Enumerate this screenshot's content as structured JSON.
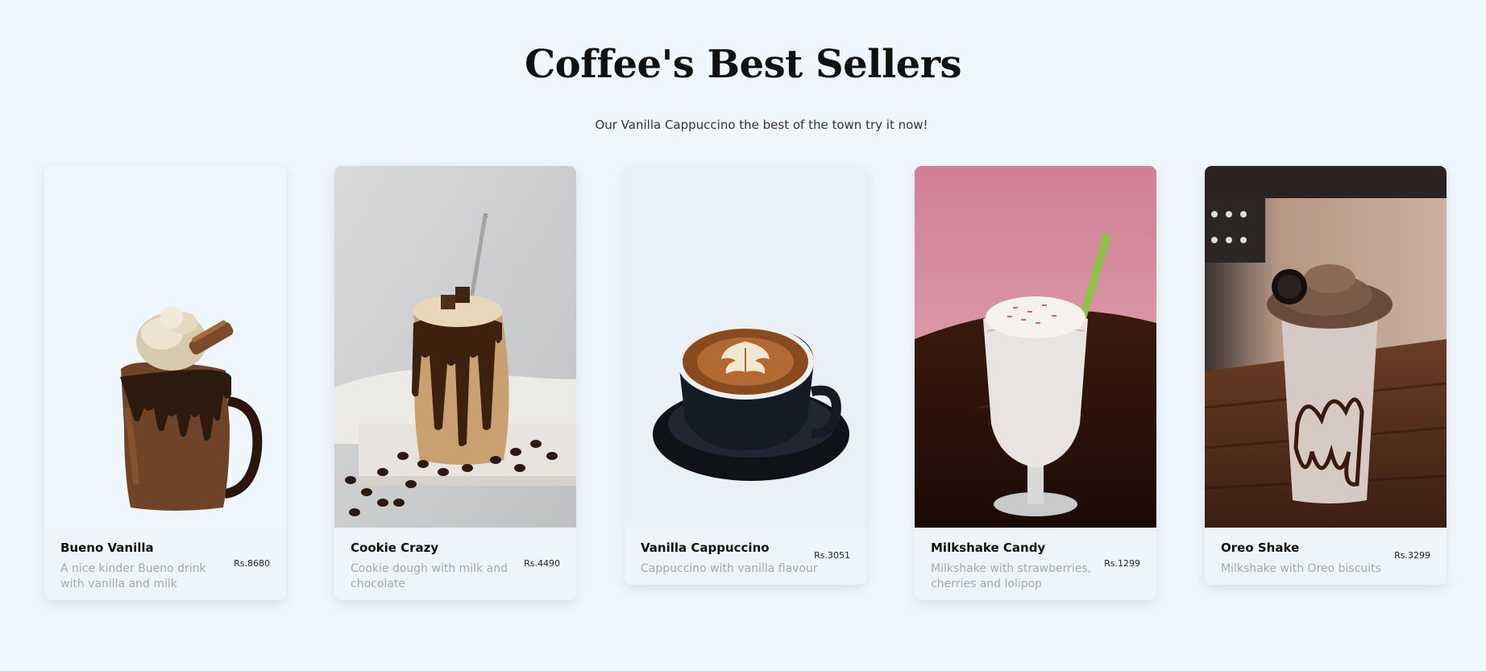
{
  "header": {
    "title": "Coffee's Best Sellers",
    "subtitle": "Our Vanilla Cappuccino the best of the town try it now!"
  },
  "products": [
    {
      "name": "Bueno Vanilla",
      "description": "A nice kinder Bueno drink with vanilla and milk",
      "price": "Rs.8680",
      "image": "chocolate-freakshake-mug-image"
    },
    {
      "name": "Cookie Crazy",
      "description": "Cookie dough with milk and chocolate",
      "price": "Rs.4490",
      "image": "cookie-jar-shake-image"
    },
    {
      "name": "Vanilla Cappuccino",
      "description": "Cappuccino with vanilla flavour",
      "price": "Rs.3051",
      "image": "latte-cup-image"
    },
    {
      "name": "Milkshake Candy",
      "description": "Milkshake with strawberries, cherries and lolipop",
      "price": "Rs.1299",
      "image": "milkshake-glass-image"
    },
    {
      "name": "Oreo Shake",
      "description": "Milkshake with Oreo biscuits",
      "price": "Rs.3299",
      "image": "oreo-shake-cup-image"
    }
  ],
  "colors": {
    "page_background": "#f0f6fd",
    "card_background": "#eef4fb",
    "description_text": "#a3a9b3"
  }
}
